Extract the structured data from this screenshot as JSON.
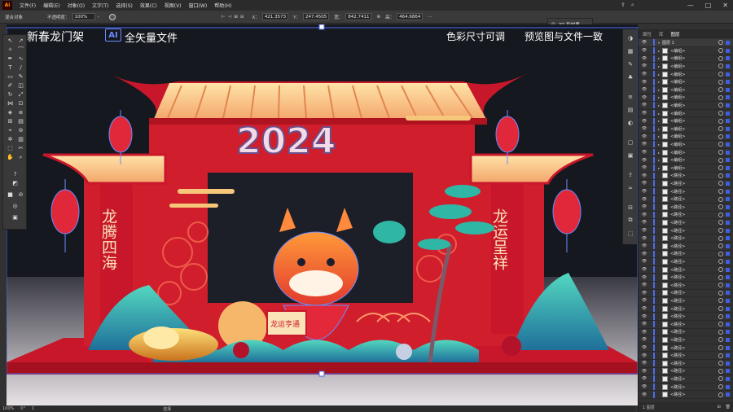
{
  "app": {
    "logo": "Ai"
  },
  "menu": [
    "文件(F)",
    "编辑(E)",
    "对象(O)",
    "文字(T)",
    "选择(S)",
    "效果(C)",
    "视图(V)",
    "窗口(W)",
    "帮助(H)"
  ],
  "window_controls": {
    "minimize": "—",
    "maximize": "□",
    "close": "✕"
  },
  "control_bar": {
    "group_label": "混合对象",
    "opacity_label": "不透明度：",
    "opacity_value": "100%",
    "x_label": "X：",
    "x_value": "421.3573",
    "y_label": "Y：",
    "y_value": "247.4505",
    "w_label": "宽：",
    "w_value": "842.7411",
    "h_label": "高：",
    "h_value": "464.6864"
  },
  "floating_panel": {
    "label": "3D 和材质"
  },
  "artwork": {
    "title_left": "新春龙门架",
    "ai_badge": "AI",
    "title_mid": "全矢量文件",
    "title_right_1": "色彩尺寸可调",
    "title_right_2": "预览图与文件一致",
    "year_text": "2024",
    "couplet_left": "龙腾四海",
    "couplet_right": "龙运呈祥",
    "scroll_text": "龙运亨通"
  },
  "layers_panel": {
    "tabs": [
      "属性",
      "库",
      "图层"
    ],
    "active_tab": "图层",
    "layer_name": "图层 1",
    "rows": [
      "<编组>",
      "<编组>",
      "<编组>",
      "<编组>",
      "<编组>",
      "<编组>",
      "<编组>",
      "<编组>",
      "<编组>",
      "<编组>",
      "<编组>",
      "<编组>",
      "<编组>",
      "<编组>",
      "<编组>",
      "<编组>",
      "<路径>",
      "<路径>",
      "<路径>",
      "<路径>",
      "<路径>",
      "<路径>",
      "<路径>",
      "<路径>",
      "<路径>",
      "<路径>",
      "<路径>",
      "<路径>",
      "<路径>",
      "<路径>",
      "<路径>",
      "<路径>",
      "<路径>",
      "<路径>",
      "<路径>",
      "<路径>",
      "<路径>",
      "<路径>",
      "<路径>",
      "<路径>",
      "<路径>",
      "<路径>",
      "<路径>",
      "<路径>",
      "<路径>"
    ],
    "footer": "1 图层"
  },
  "status_bar": {
    "zoom": "100%",
    "rotation": "0°",
    "page": "1",
    "tool": "选择"
  },
  "colors": {
    "accent": "#4b6cf0",
    "brand_red": "#d4202e",
    "gold": "#f6c77a",
    "teal": "#2fb6a5"
  }
}
